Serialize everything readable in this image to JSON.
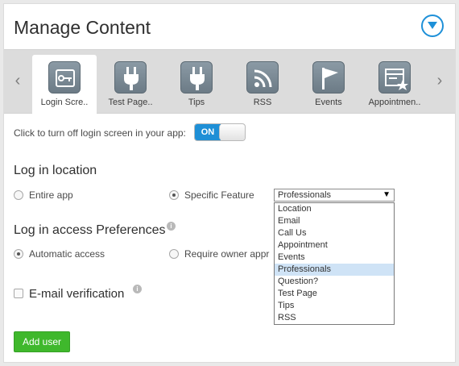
{
  "header": {
    "title": "Manage Content"
  },
  "tabs": [
    {
      "label": "Login Scre..",
      "icon": "key-card-icon",
      "active": true
    },
    {
      "label": "Test Page..",
      "icon": "plug-icon",
      "active": false
    },
    {
      "label": "Tips",
      "icon": "plug-icon",
      "active": false
    },
    {
      "label": "RSS",
      "icon": "rss-icon",
      "active": false
    },
    {
      "label": "Events",
      "icon": "flag-icon",
      "active": false
    },
    {
      "label": "Appointmen..",
      "icon": "calendar-star-icon",
      "active": false
    }
  ],
  "login_toggle": {
    "label": "Click to turn off login screen in your app:",
    "state": "ON"
  },
  "login_location": {
    "heading": "Log in location",
    "options": [
      "Entire app",
      "Specific Feature"
    ],
    "selected": "Specific Feature",
    "feature_select": {
      "value": "Professionals",
      "options": [
        "Location",
        "Email",
        "Call Us",
        "Appointment",
        "Events",
        "Professionals",
        "Question?",
        "Test Page",
        "Tips",
        "RSS"
      ]
    }
  },
  "access_preferences": {
    "heading": "Log in access Preferences",
    "options": [
      "Automatic access",
      "Require owner appr"
    ],
    "selected": "Automatic access"
  },
  "email_verification": {
    "label": "E-mail verification",
    "checked": false
  },
  "add_user": {
    "label": "Add user"
  },
  "colors": {
    "accent": "#1e8fd6",
    "button_green": "#3fb82c",
    "highlight": "#cfe3f6"
  }
}
